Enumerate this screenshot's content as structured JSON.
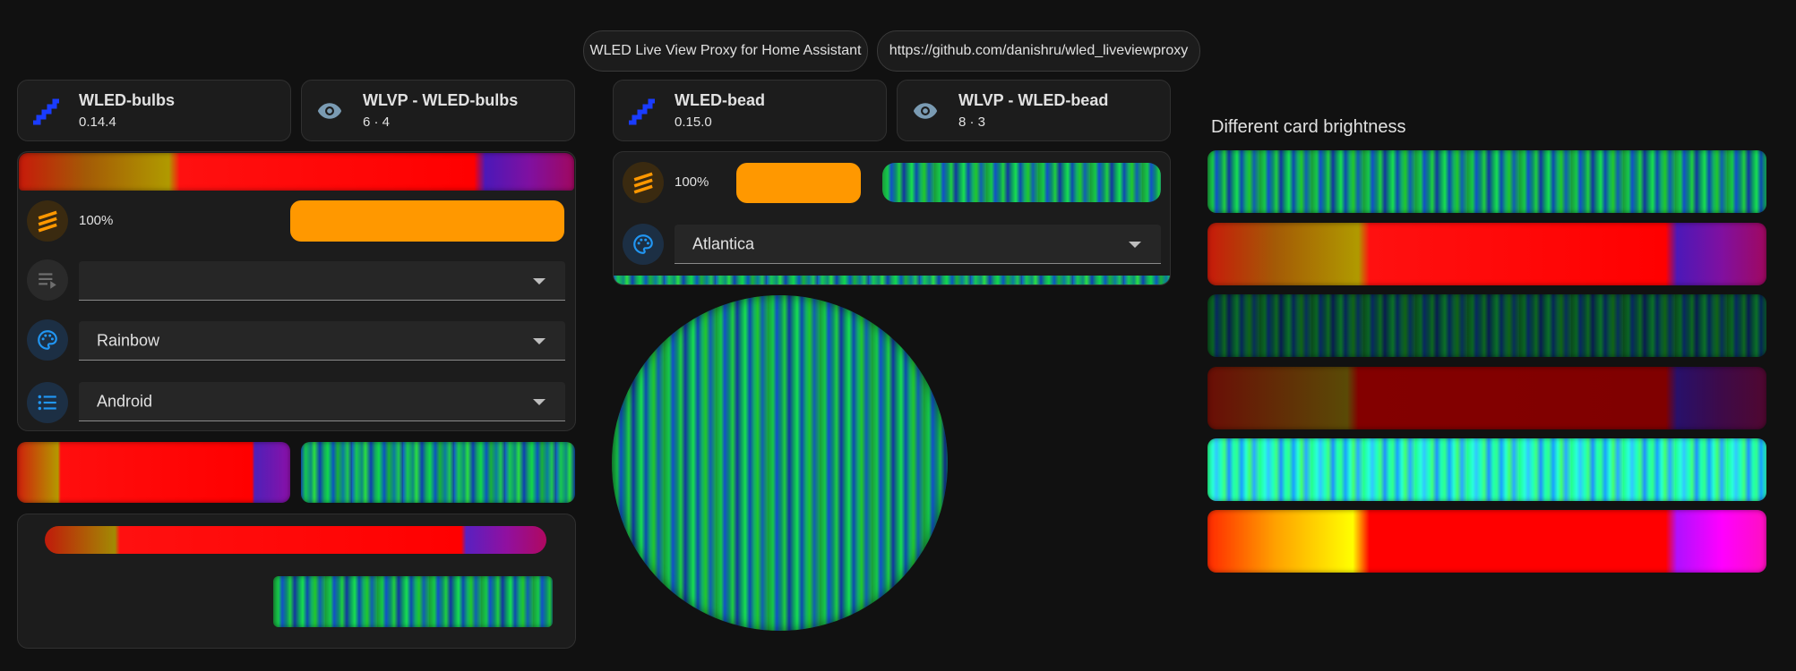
{
  "header": {
    "chip1": "WLED Live View Proxy for Home Assistant",
    "chip2": "https://github.com/danishru/wled_liveviewproxy"
  },
  "left": {
    "tile1": {
      "name": "WLED-bulbs",
      "sub": "0.14.4",
      "icon": "wled-logo-icon"
    },
    "tile2": {
      "name": "WLVP - WLED-bulbs",
      "sub": "6 · 4",
      "icon": "eye-icon"
    },
    "brightness_pct": "100%",
    "effect_select": {
      "value": "",
      "icon": "playlist-play-icon"
    },
    "palette_select": {
      "value": "Rainbow",
      "icon": "palette-icon"
    },
    "preset_select": {
      "value": "Android",
      "icon": "format-list-bulleted-icon"
    }
  },
  "middle": {
    "tile1": {
      "name": "WLED-bead",
      "sub": "0.15.0",
      "icon": "wled-logo-icon"
    },
    "tile2": {
      "name": "WLVP - WLED-bead",
      "sub": "8 · 3",
      "icon": "eye-icon"
    },
    "brightness_pct": "100%",
    "palette_select": {
      "value": "Atlantica",
      "icon": "palette-icon"
    }
  },
  "right": {
    "title": "Different card brightness"
  },
  "colors": {
    "background": "#111111",
    "card": "#1c1c1c",
    "accent_orange": "#ff9800",
    "icon_blue": "#2196f3",
    "wled_blue": "#1a3cff"
  }
}
